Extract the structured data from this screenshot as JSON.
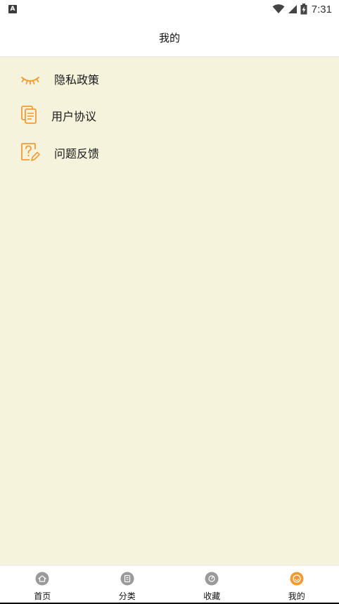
{
  "status_bar": {
    "notification_icon": "A",
    "time": "7:31"
  },
  "header": {
    "title": "我的"
  },
  "menu": {
    "items": [
      {
        "label": "隐私政策",
        "icon": "eye-closed-icon"
      },
      {
        "label": "用户协议",
        "icon": "document-icon"
      },
      {
        "label": "问题反馈",
        "icon": "question-edit-icon"
      }
    ]
  },
  "tabbar": {
    "tabs": [
      {
        "label": "首页",
        "icon": "home-icon",
        "active": false
      },
      {
        "label": "分类",
        "icon": "category-icon",
        "active": false
      },
      {
        "label": "收藏",
        "icon": "favorite-icon",
        "active": false
      },
      {
        "label": "我的",
        "icon": "profile-icon",
        "active": true
      }
    ]
  },
  "colors": {
    "accent": "#f39b33",
    "content_bg": "#f6f3dc",
    "inactive_icon": "#9a9a9a"
  }
}
